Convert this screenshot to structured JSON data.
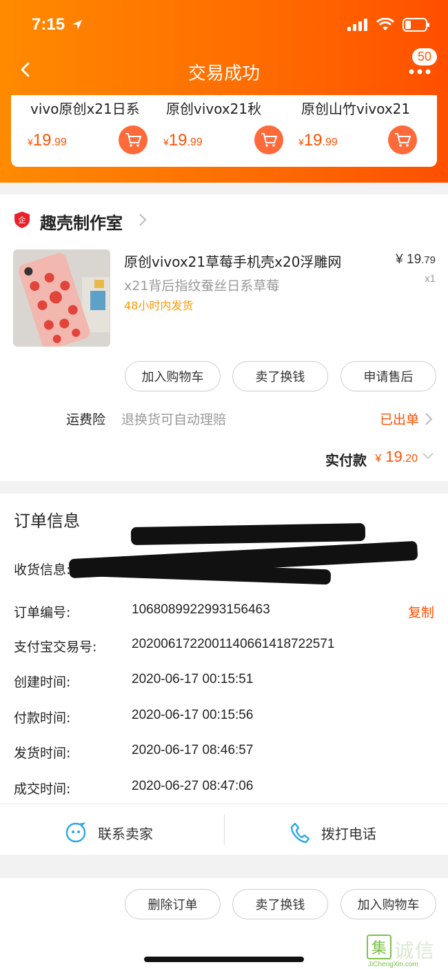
{
  "status": {
    "time": "7:15"
  },
  "nav": {
    "title": "交易成功",
    "badge": "50"
  },
  "recommendations": [
    {
      "name": "vivo原创x21日系",
      "currency": "¥",
      "price_int": "19",
      "price_dec": ".99"
    },
    {
      "name": "原创vivox21秋",
      "currency": "¥",
      "price_int": "19",
      "price_dec": ".99"
    },
    {
      "name": "原创山竹vivox21",
      "currency": "¥",
      "price_int": "19",
      "price_dec": ".99"
    }
  ],
  "shop": {
    "name": "趣壳制作室",
    "product": {
      "title": "原创vivox21草莓手机壳x20浮雕网",
      "subtitle": "x21背后指纹蚕丝日系草莓",
      "shipping": "48小时内发货",
      "price_main": "¥ 19",
      "price_dec": ".79",
      "qty": "x1"
    },
    "actions": [
      "加入购物车",
      "卖了换钱",
      "申请售后"
    ],
    "insurance": {
      "label": "运费险",
      "desc": "退换货可自动理赔",
      "status": "已出单"
    },
    "paid": {
      "label": "实付款",
      "currency": "¥",
      "int": " 19",
      "dec": ".20"
    }
  },
  "order": {
    "title": "订单信息",
    "address_label": "收货信息:",
    "rows": [
      {
        "label": "订单编号:",
        "value": "1068089922993156463"
      },
      {
        "label": "支付宝交易号:",
        "value": "2020061722001140661418722571"
      },
      {
        "label": "创建时间:",
        "value": "2020-06-17 00:15:51"
      },
      {
        "label": "付款时间:",
        "value": "2020-06-17 00:15:56"
      },
      {
        "label": "发货时间:",
        "value": "2020-06-17 08:46:57"
      },
      {
        "label": "成交时间:",
        "value": "2020-06-27 08:47:06"
      }
    ],
    "copy_label": "复制",
    "contact_seller": "联系卖家",
    "call_phone": "拨打电话"
  },
  "bottom_actions": [
    "删除订单",
    "卖了换钱",
    "加入购物车"
  ],
  "watermark": {
    "mark": "集",
    "text": "诚信",
    "sub": "JiChengXin.com"
  },
  "colors": {
    "accent": "#ff5000",
    "header_start": "#ff8a00",
    "header_end": "#ff4f00"
  }
}
